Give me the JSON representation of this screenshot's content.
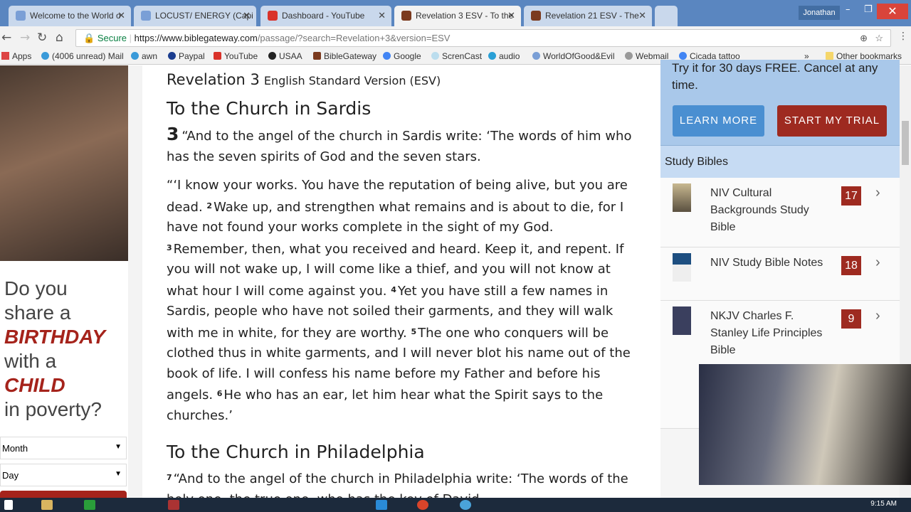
{
  "browser": {
    "tabs": [
      {
        "title": "Welcome to the World o",
        "color": "#7a9fd6"
      },
      {
        "title": "LOCUST/ ENERGY (Capi",
        "color": "#7a9fd6"
      },
      {
        "title": "Dashboard - YouTube",
        "color": "#d9322a"
      },
      {
        "title": "Revelation 3 ESV - To the",
        "color": "#7b3a1e"
      },
      {
        "title": "Revelation 21 ESV - The",
        "color": "#7b3a1e"
      }
    ],
    "profile": "Jonathan",
    "secure_label": "Secure",
    "url_host": "https://www.biblegateway.com",
    "url_rest": "/passage/?search=Revelation+3&version=ESV",
    "bookmarks": [
      "Apps",
      "(4006 unread) Mail",
      "awn",
      "Paypal",
      "YouTube",
      "USAA",
      "BibleGateway",
      "Google",
      "ScrenCast",
      "audio",
      "WorldOfGood&Evil",
      "Webmail",
      "Cicada tattoo"
    ],
    "other_bookmarks": "Other bookmarks"
  },
  "ad": {
    "line1": "Do you",
    "line2": "share a",
    "birthday": "BIRTHDAY",
    "line3": "with a",
    "child": "CHILD",
    "line4": "in poverty?",
    "month": "Month",
    "day": "Day"
  },
  "passage": {
    "book": "Revelation 3",
    "version": "English Standard Version (ESV)",
    "heading1": "To the Church in Sardis",
    "chapter": "3",
    "v1": "“And to the angel of the church in Sardis write: ‘The words of him who has the seven spirits of God and the seven stars.",
    "p2a": "“‘I know your works. You have the reputation of being alive, but you are dead. ",
    "n2": "2",
    "v2": "Wake up, and strengthen what remains and is about to die, for I have not found your works complete in the sight of my God. ",
    "n3": "3",
    "v3": "Remember, then, what you received and heard. Keep it, and repent. If you will not wake up, I will come like a thief, and you will not know at what hour I will come against you. ",
    "n4": "4",
    "v4": "Yet you have still a few names in Sardis, people who have not soiled their garments, and they will walk with me in white, for they are worthy. ",
    "n5": "5",
    "v5": "The one who conquers will be clothed thus in white garments, and I will never blot his name out of the book of life. I will confess his name before my Father and before his angels. ",
    "n6": "6",
    "v6": "He who has an ear, let him hear what the Spirit says to the churches.’",
    "heading2": "To the Church in Philadelphia",
    "n7": "7",
    "v7": "“And to the angel of the church in Philadelphia write: ‘The words of the holy one, the true one, who has the key of David..."
  },
  "sidebar": {
    "promo_top": "Try it for 30 days FREE. Cancel at any",
    "promo_bottom": "time.",
    "learn_more": "LEARN MORE",
    "start_trial": "START MY TRIAL",
    "study_heading": "Study Bibles",
    "items": [
      {
        "name": "NIV Cultural Backgrounds Study Bible",
        "count": "17"
      },
      {
        "name": "NIV Study Bible Notes",
        "count": "18"
      },
      {
        "name": "NKJV Charles F. Stanley Life Principles Bible",
        "count": "9"
      }
    ]
  },
  "taskbar": {
    "clock": "9:15 AM"
  }
}
